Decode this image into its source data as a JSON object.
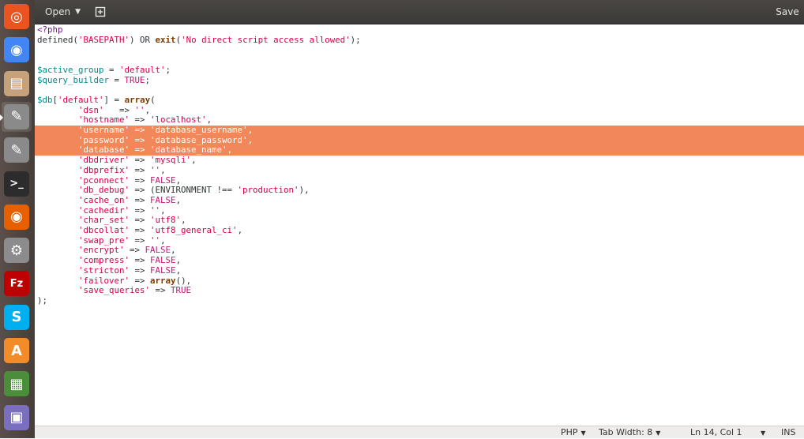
{
  "launcher": {
    "items": [
      {
        "name": "ubuntu-dash-icon",
        "bg": "#e95420",
        "glyph": "◎"
      },
      {
        "name": "chrome-browser-icon",
        "bg": "#4285f4",
        "glyph": "◉"
      },
      {
        "name": "files-icon",
        "bg": "#c6a27c",
        "glyph": "▤"
      },
      {
        "name": "text-editor-icon",
        "bg": "#8a8a8a",
        "glyph": "✎"
      },
      {
        "name": "text-editor-icon",
        "bg": "#8a8a8a",
        "glyph": "✎"
      },
      {
        "name": "terminal-icon",
        "bg": "#2c2c2c",
        "glyph": ">_"
      },
      {
        "name": "firefox-icon",
        "bg": "#e66000",
        "glyph": "◉"
      },
      {
        "name": "system-settings-icon",
        "bg": "#8c8c8c",
        "glyph": "⚙"
      },
      {
        "name": "filezilla-icon",
        "bg": "#bf0000",
        "glyph": "Fz"
      },
      {
        "name": "skype-icon",
        "bg": "#00aff0",
        "glyph": "S"
      },
      {
        "name": "software-center-icon",
        "bg": "#f28c28",
        "glyph": "A"
      },
      {
        "name": "spreadsheet-icon",
        "bg": "#4c8d3c",
        "glyph": "▦"
      },
      {
        "name": "workspace-switcher-icon",
        "bg": "#7a6fbf",
        "glyph": "▣"
      }
    ]
  },
  "toolbar": {
    "open_label": "Open",
    "save_label": "Save"
  },
  "editor": {
    "lines": [
      [
        {
          "c": "kw",
          "t": "<?php"
        }
      ],
      [
        {
          "c": "plain",
          "t": "defined("
        },
        {
          "c": "str",
          "t": "'BASEPATH'"
        },
        {
          "c": "plain",
          "t": ") OR "
        },
        {
          "c": "fn",
          "t": "exit"
        },
        {
          "c": "plain",
          "t": "("
        },
        {
          "c": "str",
          "t": "'No direct script access allowed'"
        },
        {
          "c": "plain",
          "t": ");"
        }
      ],
      [],
      [],
      [
        {
          "c": "var",
          "t": "$active_group"
        },
        {
          "c": "plain",
          "t": " = "
        },
        {
          "c": "str",
          "t": "'default'"
        },
        {
          "c": "plain",
          "t": ";"
        }
      ],
      [
        {
          "c": "var",
          "t": "$query_builder"
        },
        {
          "c": "plain",
          "t": " = "
        },
        {
          "c": "const",
          "t": "TRUE"
        },
        {
          "c": "plain",
          "t": ";"
        }
      ],
      [],
      [
        {
          "c": "var",
          "t": "$db"
        },
        {
          "c": "plain",
          "t": "["
        },
        {
          "c": "str",
          "t": "'default'"
        },
        {
          "c": "plain",
          "t": "] = "
        },
        {
          "c": "fn",
          "t": "array"
        },
        {
          "c": "plain",
          "t": "("
        }
      ],
      [
        {
          "c": "plain",
          "t": "        "
        },
        {
          "c": "str",
          "t": "'dsn'"
        },
        {
          "c": "plain",
          "t": "   => "
        },
        {
          "c": "str",
          "t": "''"
        },
        {
          "c": "plain",
          "t": ","
        }
      ],
      [
        {
          "c": "plain",
          "t": "        "
        },
        {
          "c": "str",
          "t": "'hostname'"
        },
        {
          "c": "plain",
          "t": " => "
        },
        {
          "c": "str",
          "t": "'localhost'"
        },
        {
          "c": "plain",
          "t": ","
        }
      ],
      [
        {
          "c": "plain",
          "t": "        "
        },
        {
          "c": "str",
          "t": "'username'"
        },
        {
          "c": "plain",
          "t": " => "
        },
        {
          "c": "str",
          "t": "'database_username'"
        },
        {
          "c": "plain",
          "t": ","
        }
      ],
      [
        {
          "c": "plain",
          "t": "        "
        },
        {
          "c": "str",
          "t": "'password'"
        },
        {
          "c": "plain",
          "t": " => "
        },
        {
          "c": "str",
          "t": "'database_password'"
        },
        {
          "c": "plain",
          "t": ","
        }
      ],
      [
        {
          "c": "plain",
          "t": "        "
        },
        {
          "c": "str",
          "t": "'database'"
        },
        {
          "c": "plain",
          "t": " => "
        },
        {
          "c": "str",
          "t": "'database_name'"
        },
        {
          "c": "plain",
          "t": ","
        }
      ],
      [
        {
          "c": "plain",
          "t": "        "
        },
        {
          "c": "str",
          "t": "'dbdriver'"
        },
        {
          "c": "plain",
          "t": " => "
        },
        {
          "c": "str",
          "t": "'mysqli'"
        },
        {
          "c": "plain",
          "t": ","
        }
      ],
      [
        {
          "c": "plain",
          "t": "        "
        },
        {
          "c": "str",
          "t": "'dbprefix'"
        },
        {
          "c": "plain",
          "t": " => "
        },
        {
          "c": "str",
          "t": "''"
        },
        {
          "c": "plain",
          "t": ","
        }
      ],
      [
        {
          "c": "plain",
          "t": "        "
        },
        {
          "c": "str",
          "t": "'pconnect'"
        },
        {
          "c": "plain",
          "t": " => "
        },
        {
          "c": "const",
          "t": "FALSE"
        },
        {
          "c": "plain",
          "t": ","
        }
      ],
      [
        {
          "c": "plain",
          "t": "        "
        },
        {
          "c": "str",
          "t": "'db_debug'"
        },
        {
          "c": "plain",
          "t": " => (ENVIRONMENT !== "
        },
        {
          "c": "str",
          "t": "'production'"
        },
        {
          "c": "plain",
          "t": "),"
        }
      ],
      [
        {
          "c": "plain",
          "t": "        "
        },
        {
          "c": "str",
          "t": "'cache_on'"
        },
        {
          "c": "plain",
          "t": " => "
        },
        {
          "c": "const",
          "t": "FALSE"
        },
        {
          "c": "plain",
          "t": ","
        }
      ],
      [
        {
          "c": "plain",
          "t": "        "
        },
        {
          "c": "str",
          "t": "'cachedir'"
        },
        {
          "c": "plain",
          "t": " => "
        },
        {
          "c": "str",
          "t": "''"
        },
        {
          "c": "plain",
          "t": ","
        }
      ],
      [
        {
          "c": "plain",
          "t": "        "
        },
        {
          "c": "str",
          "t": "'char_set'"
        },
        {
          "c": "plain",
          "t": " => "
        },
        {
          "c": "str",
          "t": "'utf8'"
        },
        {
          "c": "plain",
          "t": ","
        }
      ],
      [
        {
          "c": "plain",
          "t": "        "
        },
        {
          "c": "str",
          "t": "'dbcollat'"
        },
        {
          "c": "plain",
          "t": " => "
        },
        {
          "c": "str",
          "t": "'utf8_general_ci'"
        },
        {
          "c": "plain",
          "t": ","
        }
      ],
      [
        {
          "c": "plain",
          "t": "        "
        },
        {
          "c": "str",
          "t": "'swap_pre'"
        },
        {
          "c": "plain",
          "t": " => "
        },
        {
          "c": "str",
          "t": "''"
        },
        {
          "c": "plain",
          "t": ","
        }
      ],
      [
        {
          "c": "plain",
          "t": "        "
        },
        {
          "c": "str",
          "t": "'encrypt'"
        },
        {
          "c": "plain",
          "t": " => "
        },
        {
          "c": "const",
          "t": "FALSE"
        },
        {
          "c": "plain",
          "t": ","
        }
      ],
      [
        {
          "c": "plain",
          "t": "        "
        },
        {
          "c": "str",
          "t": "'compress'"
        },
        {
          "c": "plain",
          "t": " => "
        },
        {
          "c": "const",
          "t": "FALSE"
        },
        {
          "c": "plain",
          "t": ","
        }
      ],
      [
        {
          "c": "plain",
          "t": "        "
        },
        {
          "c": "str",
          "t": "'stricton'"
        },
        {
          "c": "plain",
          "t": " => "
        },
        {
          "c": "const",
          "t": "FALSE"
        },
        {
          "c": "plain",
          "t": ","
        }
      ],
      [
        {
          "c": "plain",
          "t": "        "
        },
        {
          "c": "str",
          "t": "'failover'"
        },
        {
          "c": "plain",
          "t": " => "
        },
        {
          "c": "fn",
          "t": "array"
        },
        {
          "c": "plain",
          "t": "(),"
        }
      ],
      [
        {
          "c": "plain",
          "t": "        "
        },
        {
          "c": "str",
          "t": "'save_queries'"
        },
        {
          "c": "plain",
          "t": " => "
        },
        {
          "c": "const",
          "t": "TRUE"
        }
      ],
      [
        {
          "c": "plain",
          "t": ");"
        }
      ]
    ],
    "highlighted_lines": [
      10,
      11,
      12
    ],
    "highlight_color": "#f2875a"
  },
  "statusbar": {
    "language": "PHP",
    "tab_width": "Tab Width: 8",
    "position": "Ln 14, Col 1",
    "mode": "INS"
  }
}
